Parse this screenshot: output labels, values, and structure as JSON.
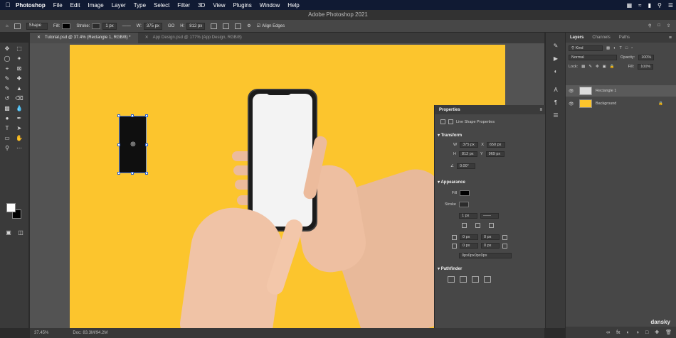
{
  "menubar": {
    "app": "Photoshop",
    "menus": [
      "File",
      "Edit",
      "Image",
      "Layer",
      "Type",
      "Select",
      "Filter",
      "3D",
      "View",
      "Plugins",
      "Window",
      "Help"
    ]
  },
  "window_title": "Adobe Photoshop 2021",
  "options": {
    "tool_mode": "Shape",
    "fill_label": "Fill:",
    "stroke_label": "Stroke:",
    "stroke_width": "1 px",
    "w_label": "W:",
    "w_value": "375 px",
    "go_label": "GO",
    "h_label": "H:",
    "h_value": "812 px",
    "align_edges": "Align Edges"
  },
  "tabs": [
    {
      "label": "Tutorial.psd @ 37.4% (Rectangle 1, RGB/8) *"
    },
    {
      "label": "App Design.psd @ 177% (App Design, RGB/8)"
    }
  ],
  "status": {
    "zoom": "37.45%",
    "doc": "Doc: 83.3M/94.2M"
  },
  "properties": {
    "title": "Properties",
    "subtitle": "Live Shape Properties",
    "transform": "Transform",
    "w": "375 px",
    "x": "650 px",
    "h": "812 px",
    "y": "969 px",
    "angle": "0.00°",
    "appearance": "Appearance",
    "fill": "Fill",
    "stroke": "Stroke",
    "stroke_size": "1 px",
    "corner_tl": "0 px",
    "corner_tr": "0 px",
    "corner_bl": "0 px",
    "corner_br": "0 px",
    "corners_all": "0px0px0px0px",
    "pathfinder": "Pathfinder"
  },
  "layers": {
    "tabs": [
      "Layers",
      "Channels",
      "Paths"
    ],
    "filter": "Kind",
    "blend": "Normal",
    "opacity_label": "Opacity:",
    "opacity": "100%",
    "lock_label": "Lock:",
    "fill_label": "Fill:",
    "fill": "100%",
    "items": [
      {
        "name": "Rectangle 1",
        "selected": true
      },
      {
        "name": "Background",
        "selected": false
      }
    ]
  },
  "watermark": "dansky",
  "colors": {
    "canvas_yellow": "#fcc52d",
    "menubar": "#101a33",
    "panel": "#474747"
  }
}
